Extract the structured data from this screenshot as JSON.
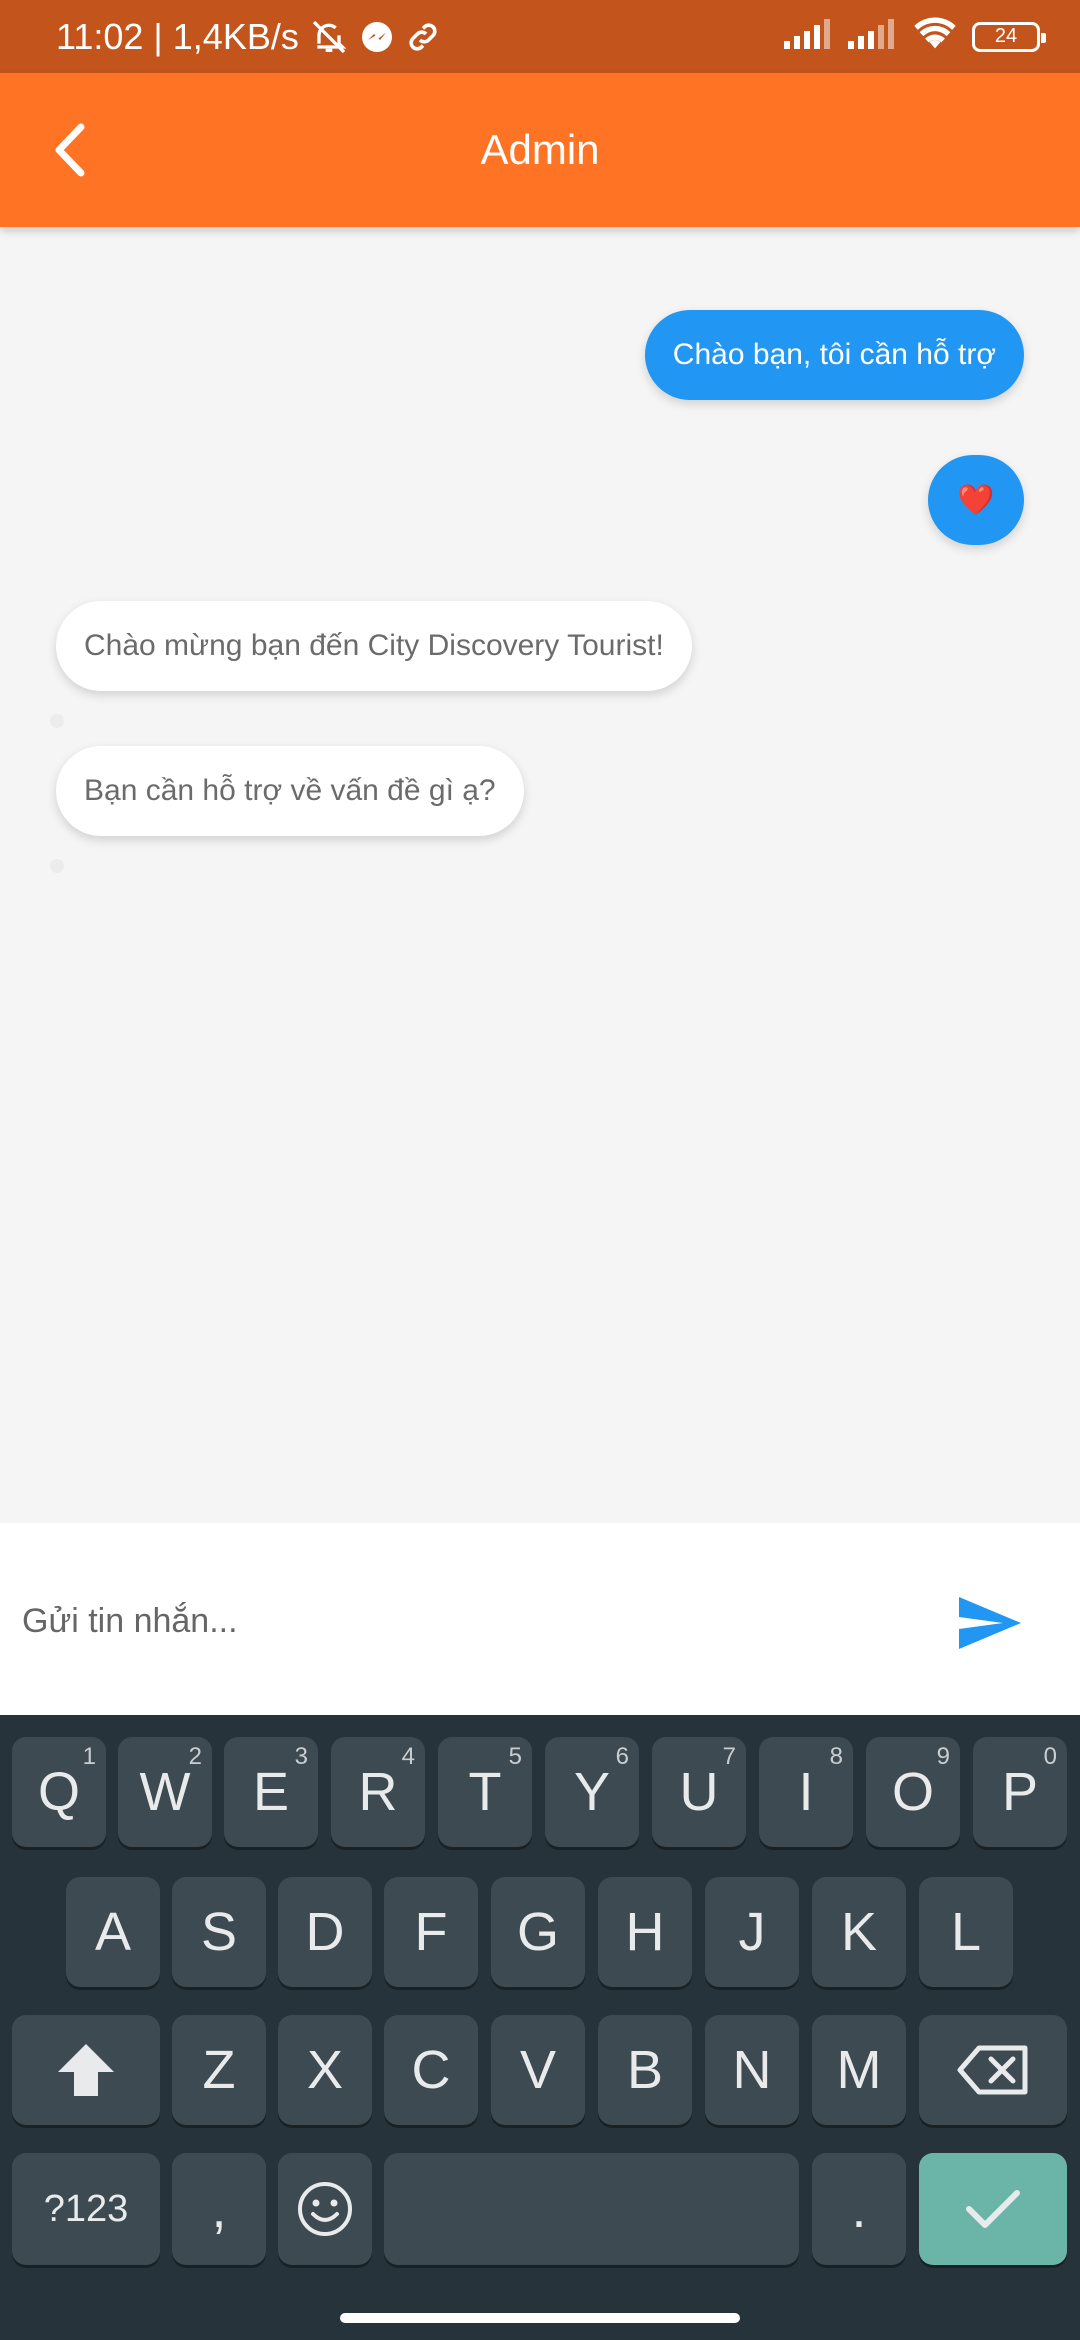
{
  "status_bar": {
    "time": "11:02",
    "separator": "|",
    "net_speed": "1,4KB/s",
    "battery_level": "24"
  },
  "app_bar": {
    "title": "Admin"
  },
  "messages": [
    {
      "text": "Chào bạn, tôi cần hỗ trợ",
      "direction": "sent"
    },
    {
      "text": "❤️",
      "direction": "sent"
    },
    {
      "text": "Chào mừng bạn đến City Discovery Tourist!",
      "direction": "received"
    },
    {
      "text": "Bạn cần hỗ trợ về vấn đề gì ạ?",
      "direction": "received"
    }
  ],
  "input": {
    "placeholder": "Gửi tin nhắn..."
  },
  "keyboard": {
    "row1": [
      {
        "label": "Q",
        "hint": "1"
      },
      {
        "label": "W",
        "hint": "2"
      },
      {
        "label": "E",
        "hint": "3"
      },
      {
        "label": "R",
        "hint": "4"
      },
      {
        "label": "T",
        "hint": "5"
      },
      {
        "label": "Y",
        "hint": "6"
      },
      {
        "label": "U",
        "hint": "7"
      },
      {
        "label": "I",
        "hint": "8"
      },
      {
        "label": "O",
        "hint": "9"
      },
      {
        "label": "P",
        "hint": "0"
      }
    ],
    "row2": [
      "A",
      "S",
      "D",
      "F",
      "G",
      "H",
      "J",
      "K",
      "L"
    ],
    "row3": [
      "Z",
      "X",
      "C",
      "V",
      "B",
      "N",
      "M"
    ],
    "symbols_label": "?123",
    "comma_label": ",",
    "period_label": "."
  },
  "colors": {
    "status_bar": "#c2541c",
    "app_bar": "#ff7324",
    "sent_bubble": "#2196f3",
    "received_bubble": "#ffffff",
    "keyboard_bg": "#27333a",
    "key_bg": "#3d4a52",
    "enter_key": "#6bb5a8"
  },
  "icons": {
    "back": "back-arrow-icon",
    "send": "send-icon",
    "shift": "shift-icon",
    "backspace": "backspace-icon",
    "emoji": "emoji-icon",
    "enter": "check-icon"
  }
}
